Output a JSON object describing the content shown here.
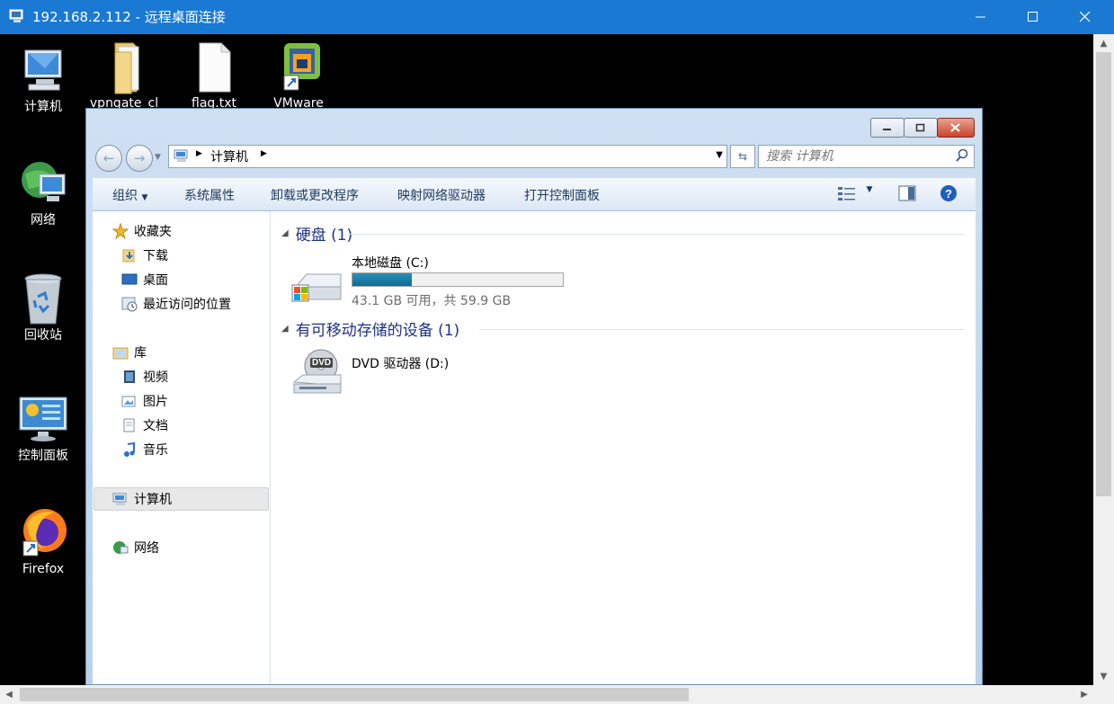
{
  "rdp": {
    "title": "192.168.2.112 - 远程桌面连接",
    "minimize": "—",
    "maximize": "☐",
    "close": "✕"
  },
  "desktop": {
    "icons": [
      {
        "label": "计算机"
      },
      {
        "label": "vpngate_cl"
      },
      {
        "label": "flag.txt"
      },
      {
        "label": "VMware"
      },
      {
        "label": "网络"
      },
      {
        "label": "回收站"
      },
      {
        "label": "控制面板"
      },
      {
        "label": "Firefox"
      }
    ]
  },
  "explorer": {
    "address": {
      "crumbs": [
        "计算机"
      ]
    },
    "search": {
      "placeholder": "搜索 计算机"
    },
    "toolbar": {
      "organize": "组织",
      "system_properties": "系统属性",
      "uninstall": "卸载或更改程序",
      "map_drive": "映射网络驱动器",
      "control_panel": "打开控制面板"
    },
    "nav": {
      "favorites": "收藏夹",
      "downloads": "下载",
      "desktop": "桌面",
      "recent": "最近访问的位置",
      "libraries": "库",
      "videos": "视频",
      "pictures": "图片",
      "documents": "文档",
      "music": "音乐",
      "computer": "计算机",
      "network": "网络"
    },
    "groups": {
      "hard_disks": "硬盘 (1)",
      "removable": "有可移动存储的设备 (1)"
    },
    "drives": {
      "c": {
        "name": "本地磁盘 (C:)",
        "usage": "43.1 GB 可用，共 59.9 GB",
        "used_fraction": 0.28
      },
      "d": {
        "name": "DVD 驱动器 (D:)",
        "badge": "DVD"
      }
    }
  },
  "colors": {
    "rdp_bar": "#1979d3",
    "accent_header": "#1e3287",
    "bar_fill": "#1a7ea6"
  }
}
